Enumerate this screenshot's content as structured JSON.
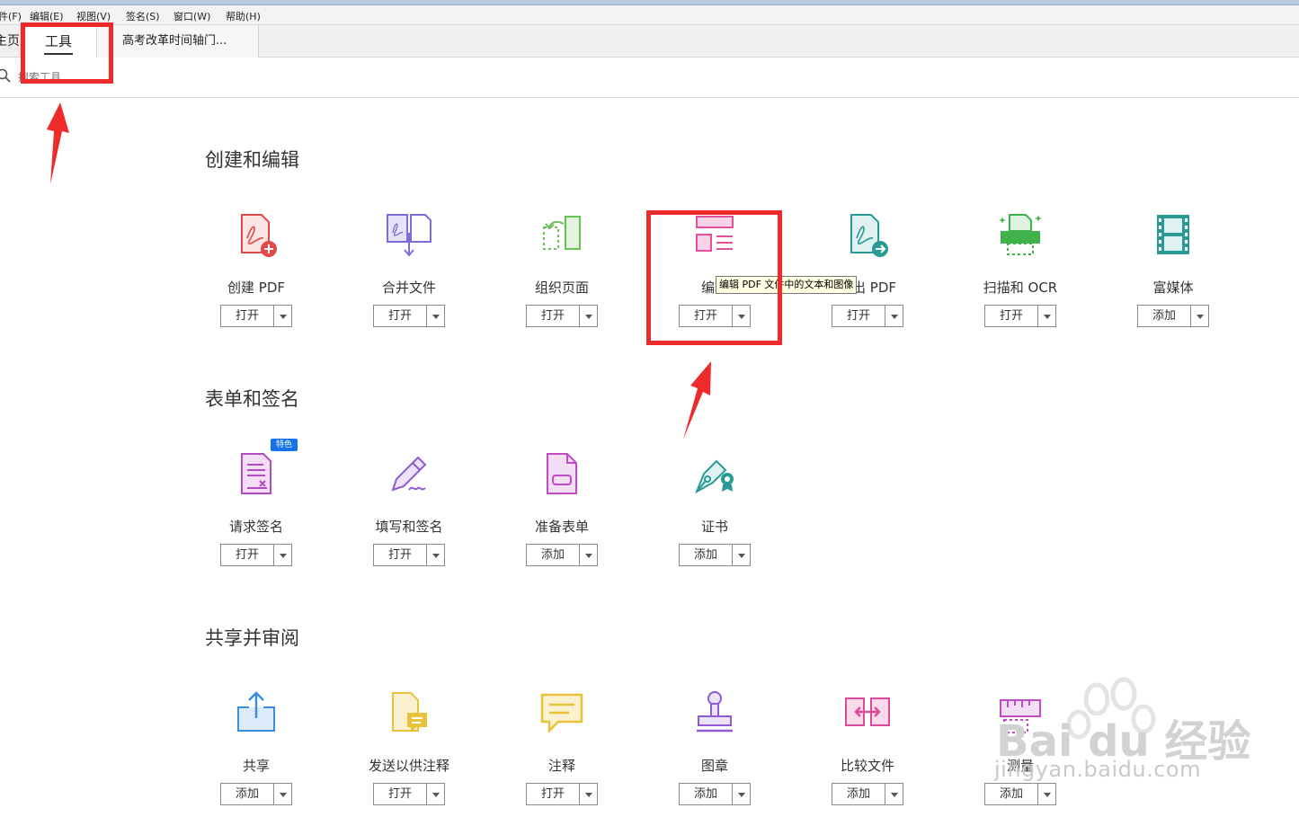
{
  "menubar": {
    "items": [
      "件(F)",
      "编辑(E)",
      "视图(V)",
      "签名(S)",
      "窗口(W)",
      "帮助(H)"
    ]
  },
  "tabs": {
    "home": "主页",
    "tools": "工具",
    "document": "高考改革时间轴门..."
  },
  "search": {
    "placeholder": "搜索工具"
  },
  "sections": [
    {
      "title": "创建和编辑",
      "tools": [
        {
          "label": "创建 PDF",
          "action": "打开"
        },
        {
          "label": "合并文件",
          "action": "打开"
        },
        {
          "label": "组织页面",
          "action": "打开"
        },
        {
          "label": "编辑",
          "action": "打开"
        },
        {
          "label": "导出 PDF",
          "action": "打开"
        },
        {
          "label": "扫描和 OCR",
          "action": "打开"
        },
        {
          "label": "富媒体",
          "action": "添加"
        }
      ]
    },
    {
      "title": "表单和签名",
      "tools": [
        {
          "label": "请求签名",
          "action": "打开",
          "badge": "特色"
        },
        {
          "label": "填写和签名",
          "action": "打开"
        },
        {
          "label": "准备表单",
          "action": "添加"
        },
        {
          "label": "证书",
          "action": "添加"
        }
      ]
    },
    {
      "title": "共享并审阅",
      "tools": [
        {
          "label": "共享",
          "action": "添加"
        },
        {
          "label": "发送以供注释",
          "action": "打开"
        },
        {
          "label": "注释",
          "action": "打开"
        },
        {
          "label": "图章",
          "action": "添加"
        },
        {
          "label": "比较文件",
          "action": "添加"
        },
        {
          "label": "测量",
          "action": "添加"
        }
      ]
    }
  ],
  "tooltip": "编辑 PDF 文件中的文本和图像",
  "watermark": {
    "brand": "Bai du 经验",
    "url": "jingyan.baidu.com"
  },
  "colors": {
    "highlight": "#ed2b2b",
    "create_pdf": "#e04a4a",
    "combine": "#7b6fd6",
    "organize": "#6bbf59",
    "edit": "#e54f9b",
    "export": "#2a9a95",
    "scan": "#3fb24b",
    "rich_media": "#2a9a95",
    "request_sign": "#b04bc2",
    "fill_sign": "#8e5bd4",
    "prepare_form": "#c14bc2",
    "certificate": "#2a9a95",
    "share": "#3b8ede",
    "send_comment": "#e8c23a",
    "comment": "#e8c23a",
    "stamp": "#8e5bd4",
    "compare": "#d94b9a",
    "measure": "#c14bc2"
  }
}
